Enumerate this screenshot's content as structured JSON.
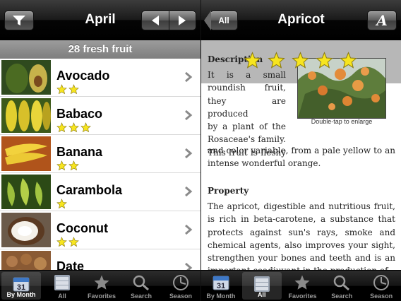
{
  "left": {
    "title": "April",
    "section_header": "28 fresh fruit",
    "rows": [
      {
        "name": "Avocado",
        "rating": 2
      },
      {
        "name": "Babaco",
        "rating": 3
      },
      {
        "name": "Banana",
        "rating": 2
      },
      {
        "name": "Carambola",
        "rating": 1
      },
      {
        "name": "Coconut",
        "rating": 2
      },
      {
        "name": "Date",
        "rating": 0
      }
    ],
    "tabs": [
      {
        "label": "By Month",
        "icon": "calendar-icon",
        "calendar_day": "31",
        "selected": true
      },
      {
        "label": "All",
        "icon": "list-icon",
        "selected": false
      },
      {
        "label": "Favorites",
        "icon": "star-icon",
        "selected": false
      },
      {
        "label": "Search",
        "icon": "search-icon",
        "selected": false
      },
      {
        "label": "Season",
        "icon": "season-icon",
        "selected": false
      }
    ]
  },
  "right": {
    "back_label": "All",
    "title": "Apricot",
    "rating": 5,
    "description_label": "Description",
    "description_left_lines": [
      "It is a small",
      "roundish fruit,",
      "they are produced",
      "by a plant of the",
      "Rosaceae's family.",
      "This fruit is fleshy"
    ],
    "description_continuation": "and color variable, from a pale yellow to an intense wonderful orange.",
    "image_caption": "Double-tap to enlarge",
    "property_label": "Property",
    "property_text": "The apricot, digestible and nutritious fruit, is rich in beta-carotene, a substance that protects against sun's rays, smoke and chemical agents, also improves your sight, strengthen your bones and teeth and is an important coadiuvant in the production of",
    "tabs": [
      {
        "label": "By Month",
        "icon": "calendar-icon",
        "calendar_day": "31",
        "selected": false
      },
      {
        "label": "All",
        "icon": "list-icon",
        "selected": true
      },
      {
        "label": "Favorites",
        "icon": "star-icon",
        "selected": false
      },
      {
        "label": "Search",
        "icon": "search-icon",
        "selected": false
      },
      {
        "label": "Season",
        "icon": "season-icon",
        "selected": false
      }
    ]
  },
  "colors": {
    "star_fill": "#f7e51f",
    "star_stroke": "#8a7a10",
    "nav_bg": "#1a1a1a",
    "section_header_bg": "#8c8c8c"
  }
}
